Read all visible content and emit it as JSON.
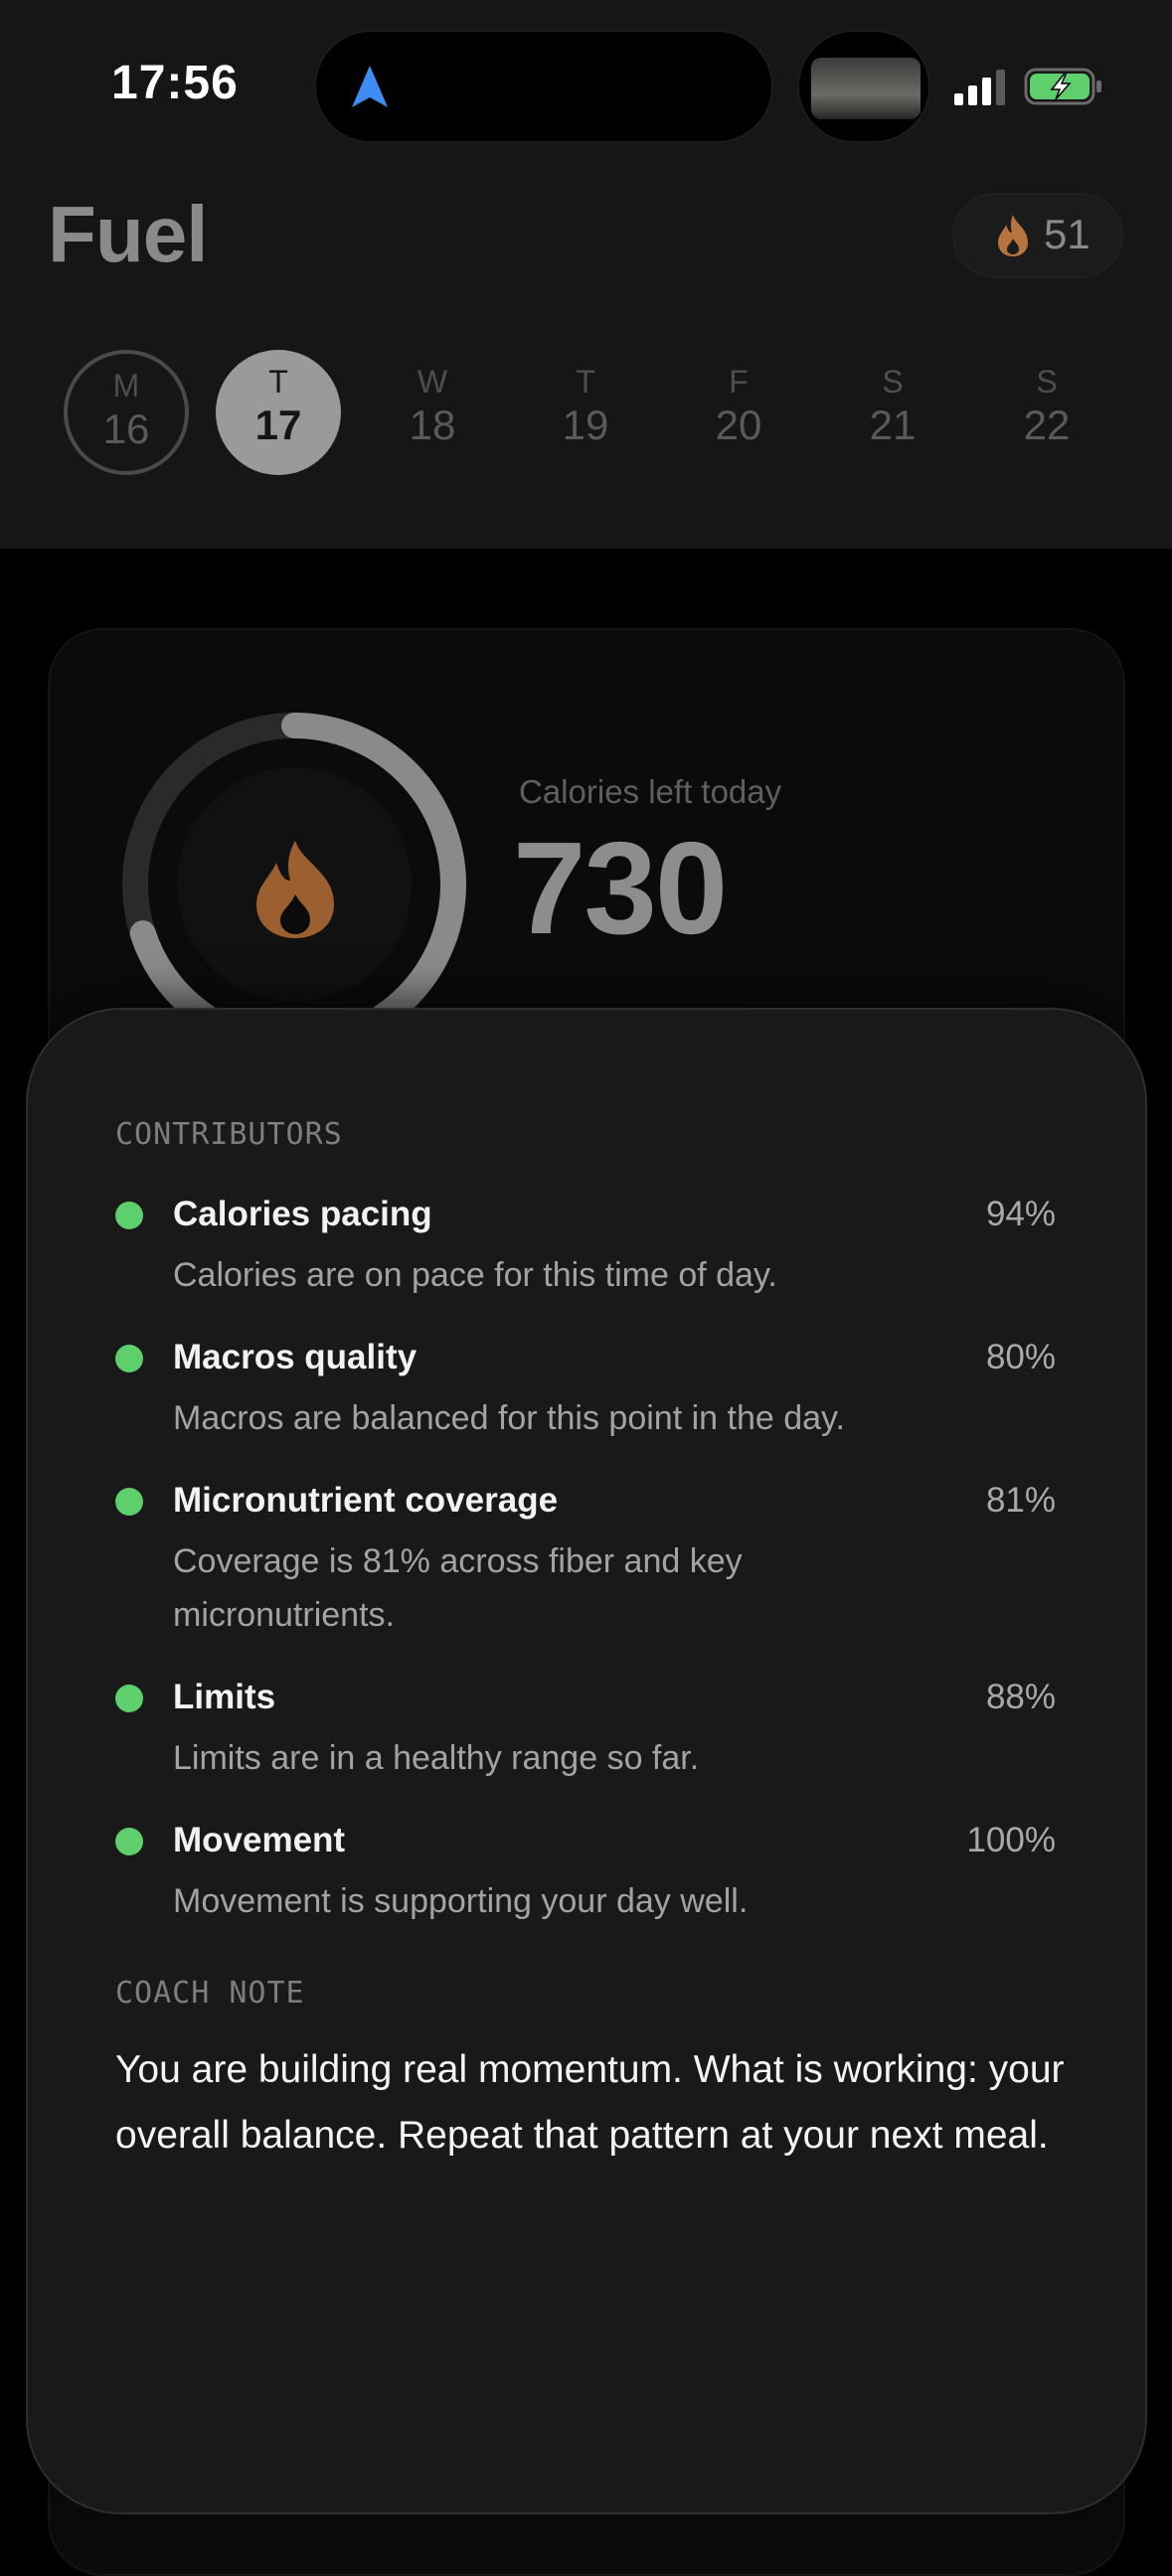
{
  "status_bar": {
    "time": "17:56"
  },
  "header": {
    "title": "Fuel",
    "streak_count": "51",
    "days": [
      {
        "letter": "M",
        "number": "16"
      },
      {
        "letter": "T",
        "number": "17"
      },
      {
        "letter": "W",
        "number": "18"
      },
      {
        "letter": "T",
        "number": "19"
      },
      {
        "letter": "F",
        "number": "20"
      },
      {
        "letter": "S",
        "number": "21"
      },
      {
        "letter": "S",
        "number": "22"
      }
    ]
  },
  "calories": {
    "label": "Calories left today",
    "value": "730",
    "ring_progress": 0.7
  },
  "sheet": {
    "contributors_label": "CONTRIBUTORS",
    "contributors": [
      {
        "title": "Calories pacing",
        "percent": "94%",
        "description": "Calories are on pace for this time of day."
      },
      {
        "title": "Macros quality",
        "percent": "80%",
        "description": "Macros are balanced for this point in the day."
      },
      {
        "title": "Micronutrient coverage",
        "percent": "81%",
        "description": "Coverage is 81% across fiber and key micronutrients."
      },
      {
        "title": "Limits",
        "percent": "88%",
        "description": "Limits are in a healthy range so far."
      },
      {
        "title": "Movement",
        "percent": "100%",
        "description": "Movement is supporting your day well."
      }
    ],
    "coach_label": "COACH NOTE",
    "coach_note": "You are building real momentum. What is working: your overall balance. Repeat that pattern at your next meal."
  },
  "colors": {
    "accent_green": "#5fcf6d",
    "flame_orange": "#b8743e",
    "nav_blue": "#3f8cf5"
  }
}
